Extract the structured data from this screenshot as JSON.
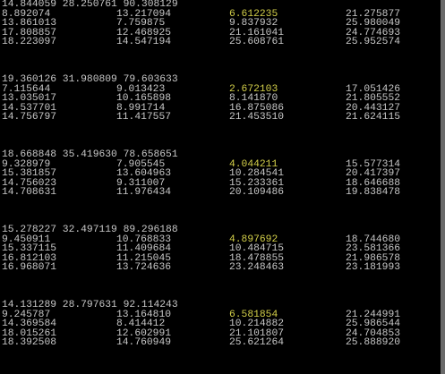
{
  "accent_color": "#d4d04a",
  "text_color": "#c8c8c8",
  "blocks": [
    {
      "header": "14.844059 28.250761 90.308129",
      "rows": [
        [
          "8.892074",
          "13.217094",
          "6.612235",
          "21.275877"
        ],
        [
          "13.861013",
          "7.759875",
          "9.837932",
          "25.980049"
        ],
        [
          "17.808857",
          "12.468925",
          "21.161041",
          "24.774693"
        ],
        [
          "18.223097",
          "14.547194",
          "25.608761",
          "25.952574"
        ]
      ]
    },
    {
      "header": "19.360126 31.980809 79.603633",
      "rows": [
        [
          "7.115644",
          "9.013423",
          "2.672103",
          "17.051426"
        ],
        [
          "13.035017",
          "10.165898",
          "8.141870",
          "21.805552"
        ],
        [
          "14.537701",
          "8.991714",
          "16.875086",
          "20.443127"
        ],
        [
          "14.756797",
          "11.417557",
          "21.453510",
          "21.624115"
        ]
      ]
    },
    {
      "header": "18.668848 35.419630 78.658651",
      "rows": [
        [
          "9.328979",
          "7.905545",
          "4.044211",
          "15.577314"
        ],
        [
          "15.381857",
          "13.604963",
          "10.284541",
          "20.417397"
        ],
        [
          "14.756023",
          "9.311007",
          "15.233361",
          "18.646688"
        ],
        [
          "14.708631",
          "11.976434",
          "20.109486",
          "19.838478"
        ]
      ]
    },
    {
      "header": "15.278227 32.497119 89.296188",
      "rows": [
        [
          "9.450911",
          "10.768833",
          "4.897692",
          "18.744680"
        ],
        [
          "15.337115",
          "11.409684",
          "10.484715",
          "23.581366"
        ],
        [
          "16.812103",
          "11.215045",
          "18.478855",
          "21.986578"
        ],
        [
          "16.968071",
          "13.724636",
          "23.248463",
          "23.181993"
        ]
      ]
    },
    {
      "header": "14.131289 28.797631 92.114243",
      "rows": [
        [
          "9.245787",
          "13.164810",
          "6.581854",
          "21.244991"
        ],
        [
          "14.369584",
          "8.414412",
          "10.214882",
          "25.986544"
        ],
        [
          "18.015261",
          "12.602991",
          "21.101807",
          "24.704853"
        ],
        [
          "18.392508",
          "14.760949",
          "25.621264",
          "25.888920"
        ]
      ]
    }
  ]
}
